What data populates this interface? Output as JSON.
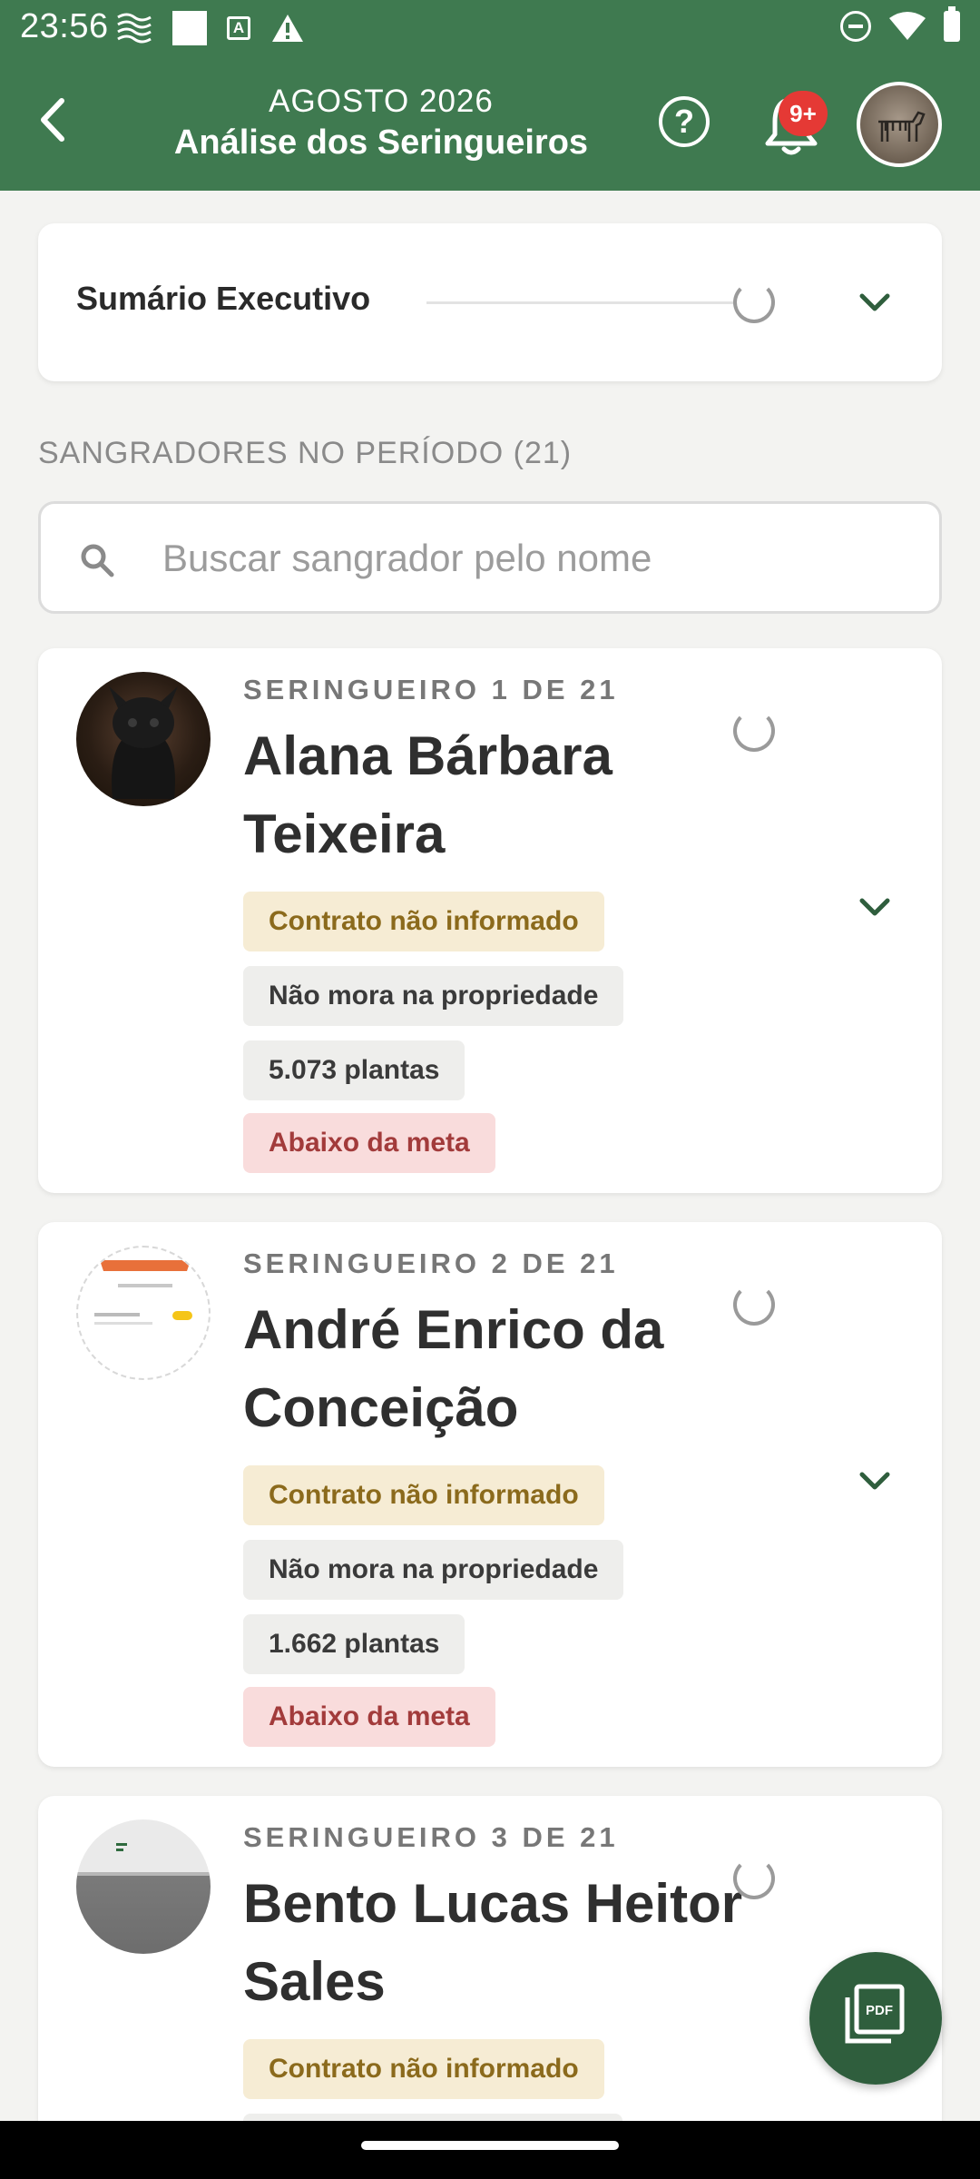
{
  "status_bar": {
    "time": "23:56"
  },
  "header": {
    "period": "AGOSTO 2026",
    "title": "Análise dos Seringueiros",
    "notification_badge": "9+"
  },
  "summary": {
    "title": "Sumário Executivo"
  },
  "tappers_section": {
    "label": "SANGRADORES NO PERÍODO (21)",
    "search_placeholder": "Buscar sangrador pelo nome"
  },
  "tappers": [
    {
      "index_label": "SERINGUEIRO 1 DE 21",
      "name": "Alana Bárbara Teixeira",
      "contract": "Contrato não informado",
      "residence": "Não mora na propriedade",
      "plants": "5.073 plantas",
      "goal_status": "Abaixo da meta"
    },
    {
      "index_label": "SERINGUEIRO 2 DE 21",
      "name": "André Enrico da Conceição",
      "contract": "Contrato não informado",
      "residence": "Não mora na propriedade",
      "plants": "1.662 plantas",
      "goal_status": "Abaixo da meta"
    },
    {
      "index_label": "SERINGUEIRO 3 DE 21",
      "name": "Bento Lucas Heitor Sales",
      "contract": "Contrato não informado"
    }
  ],
  "fab": {
    "icon": "pdf-icon",
    "label": "PDF"
  },
  "colors": {
    "primary": "#3f7a50",
    "fab": "#2f5e3d",
    "badge": "#e53935",
    "contract_chip_bg": "#f6ecd4",
    "alert_chip_bg": "#f9dcdc"
  }
}
